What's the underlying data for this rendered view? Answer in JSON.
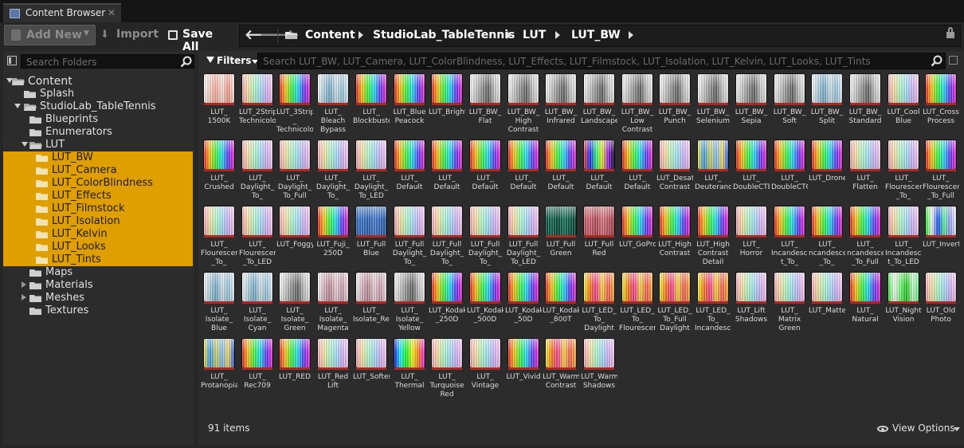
{
  "tab": {
    "title": "Content Browser",
    "close": "✕"
  },
  "toolbar": {
    "add_new": "Add New",
    "import": "Import",
    "save_all": "Save All"
  },
  "breadcrumbs": [
    "Content",
    "StudioLab_TableTennis",
    "LUT",
    "LUT_BW"
  ],
  "folder_search": {
    "placeholder": "Search Folders"
  },
  "tree": [
    {
      "label": "Content",
      "depth": 0,
      "arrow": "open",
      "selected": false
    },
    {
      "label": "Splash",
      "depth": 1,
      "arrow": "none",
      "selected": false
    },
    {
      "label": "StudioLab_TableTennis",
      "depth": 1,
      "arrow": "open",
      "selected": false
    },
    {
      "label": "Blueprints",
      "depth": 2,
      "arrow": "none",
      "selected": false
    },
    {
      "label": "Enumerators",
      "depth": 2,
      "arrow": "none",
      "selected": false
    },
    {
      "label": "LUT",
      "depth": 2,
      "arrow": "open",
      "selected": false
    },
    {
      "label": "LUT_BW",
      "depth": 3,
      "arrow": "none",
      "selected": true
    },
    {
      "label": "LUT_Camera",
      "depth": 3,
      "arrow": "none",
      "selected": true
    },
    {
      "label": "LUT_ColorBlindness",
      "depth": 3,
      "arrow": "none",
      "selected": true
    },
    {
      "label": "LUT_Effects",
      "depth": 3,
      "arrow": "none",
      "selected": true
    },
    {
      "label": "LUT_Filmstock",
      "depth": 3,
      "arrow": "none",
      "selected": true
    },
    {
      "label": "LUT_Isolation",
      "depth": 3,
      "arrow": "none",
      "selected": true
    },
    {
      "label": "LUT_Kelvin",
      "depth": 3,
      "arrow": "none",
      "selected": true
    },
    {
      "label": "LUT_Looks",
      "depth": 3,
      "arrow": "none",
      "selected": true
    },
    {
      "label": "LUT_Tints",
      "depth": 3,
      "arrow": "none",
      "selected": true
    },
    {
      "label": "Maps",
      "depth": 2,
      "arrow": "none",
      "selected": false
    },
    {
      "label": "Materials",
      "depth": 2,
      "arrow": "closed",
      "selected": false
    },
    {
      "label": "Meshes",
      "depth": 2,
      "arrow": "closed",
      "selected": false
    },
    {
      "label": "Textures",
      "depth": 2,
      "arrow": "none",
      "selected": false
    }
  ],
  "filters": {
    "label": "Filters"
  },
  "asset_search": {
    "placeholder": "Search LUT_BW, LUT_Camera, LUT_ColorBlindness, LUT_Effects, LUT_Filmstock, LUT_Isolation, LUT_Kelvin, LUT_Looks, LUT_Tints"
  },
  "assets": [
    {
      "label": "LUT_\n1500K",
      "palette": "white-red"
    },
    {
      "label": "LUT_2Strip\nTechnicolor",
      "palette": "pastel"
    },
    {
      "label": "LUT_3Strip\n_\nTechnicolor",
      "palette": "rainbow"
    },
    {
      "label": "LUT_\nBleach\nBypass",
      "palette": "grey-cool"
    },
    {
      "label": "LUT_\nBlockbuster",
      "palette": "rainbow"
    },
    {
      "label": "LUT_Blue\nPeacock",
      "palette": "rainbow"
    },
    {
      "label": "LUT_Bright",
      "palette": "rainbow"
    },
    {
      "label": "LUT_BW_\nFlat",
      "palette": "grey"
    },
    {
      "label": "LUT_BW_\nHigh\nContrast",
      "palette": "grey"
    },
    {
      "label": "LUT_BW_\nInfrared",
      "palette": "grey"
    },
    {
      "label": "LUT_BW_\nLandscape",
      "palette": "grey"
    },
    {
      "label": "LUT_BW_\nLow\nContrast",
      "palette": "grey"
    },
    {
      "label": "LUT_BW_\nPunch",
      "palette": "grey"
    },
    {
      "label": "LUT_BW_\nSelenium",
      "palette": "grey"
    },
    {
      "label": "LUT_BW_\nSepia",
      "palette": "grey"
    },
    {
      "label": "LUT_BW_\nSoft",
      "palette": "grey"
    },
    {
      "label": "LUT_BW_\nSplit",
      "palette": "grey-cool"
    },
    {
      "label": "LUT_BW_\nStandard",
      "palette": "grey"
    },
    {
      "label": "LUT_Cool\nBlue",
      "palette": "pastel"
    },
    {
      "label": "LUT_Cross\nProcess",
      "palette": "rainbow"
    },
    {
      "label": "LUT_\nCrushed",
      "palette": "rainbow"
    },
    {
      "label": "LUT_\nDaylight_\nTo_",
      "palette": "pastel"
    },
    {
      "label": "LUT_\nDaylight_\nTo_Full",
      "palette": "pastel"
    },
    {
      "label": "LUT_\nDaylight_\nTo_",
      "palette": "pastel"
    },
    {
      "label": "LUT_\nDaylight_\nTo_LED",
      "palette": "pastel"
    },
    {
      "label": "LUT_\nDefault",
      "palette": "rainbow"
    },
    {
      "label": "LUT_\nDefault",
      "palette": "rainbow"
    },
    {
      "label": "LUT_\nDefault",
      "palette": "rainbow"
    },
    {
      "label": "LUT_\nDefault",
      "palette": "rainbow"
    },
    {
      "label": "LUT_\nDefault",
      "palette": "rainbow"
    },
    {
      "label": "LUT_\nDefault",
      "palette": "dark"
    },
    {
      "label": "LUT_\nDefault",
      "palette": "rainbow"
    },
    {
      "label": "LUT_Desat\nContrast",
      "palette": "pastel"
    },
    {
      "label": "LUT_\nDeuteranopia",
      "palette": "yellow-blue"
    },
    {
      "label": "LUT_\nDoubleCTB",
      "palette": "rainbow"
    },
    {
      "label": "LUT_\nDoubleCTO",
      "palette": "rainbow"
    },
    {
      "label": "LUT_Drone",
      "palette": "rainbow"
    },
    {
      "label": "LUT_\nFlatten",
      "palette": "pastel"
    },
    {
      "label": "LUT_\nFlourescent\n_To_",
      "palette": "pastel"
    },
    {
      "label": "LUT_\nFlourescent\n_To_Full",
      "palette": "rainbow"
    },
    {
      "label": "LUT_\nFlourescent\n_To_",
      "palette": "pastel"
    },
    {
      "label": "LUT_\nFlourescent\n_To_LED",
      "palette": "pastel"
    },
    {
      "label": "LUT_Foggy",
      "palette": "pastel"
    },
    {
      "label": "LUT_Fuji_\n250D",
      "palette": "rainbow"
    },
    {
      "label": "LUT_Full\nBlue",
      "palette": "blue"
    },
    {
      "label": "LUT_Full\nDaylight_\nTo_",
      "palette": "pastel"
    },
    {
      "label": "LUT_Full\nDaylight_\nTo_",
      "palette": "pastel"
    },
    {
      "label": "LUT_Full\nDaylight_\nTo_",
      "palette": "pastel"
    },
    {
      "label": "LUT_Full\nDaylight_\nTo_LED",
      "palette": "pastel"
    },
    {
      "label": "LUT_Full\nGreen",
      "palette": "green"
    },
    {
      "label": "LUT_Full\nRed",
      "palette": "red"
    },
    {
      "label": "LUT_GoPro",
      "palette": "rainbow"
    },
    {
      "label": "LUT_High\nContrast",
      "palette": "rainbow"
    },
    {
      "label": "LUT_High\nContrast\nDetail",
      "palette": "rainbow"
    },
    {
      "label": "LUT_\nHorror",
      "palette": "pastel"
    },
    {
      "label": "LUT_\nIncandescen\nt_To_",
      "palette": "rainbow"
    },
    {
      "label": "LUT_\nncandescent\n_To_",
      "palette": "rainbow"
    },
    {
      "label": "LUT_\nncandescent\n_To_Full",
      "palette": "rainbow"
    },
    {
      "label": "LUT_\nIncandescen\nt_To_LED",
      "palette": "pastel"
    },
    {
      "label": "LUT_Invert",
      "palette": "invert"
    },
    {
      "label": "LUT_\nIsolate_\nBlue",
      "palette": "grey-cool"
    },
    {
      "label": "LUT_\nIsolate_\nCyan",
      "palette": "grey-cool"
    },
    {
      "label": "LUT_\nIsolate_\nGreen",
      "palette": "grey"
    },
    {
      "label": "LUT_\nIsolate_\nMagenta",
      "palette": "grey-warm"
    },
    {
      "label": "LUT_\nIsolate_Red",
      "palette": "grey-warm"
    },
    {
      "label": "LUT_\nIsolate_\nYellow",
      "palette": "grey"
    },
    {
      "label": "LUT_Kodak\n_250D",
      "palette": "rainbow"
    },
    {
      "label": "LUT_Kodak\n_500D",
      "palette": "rainbow"
    },
    {
      "label": "LUT_Kodak\n_50D",
      "palette": "rainbow"
    },
    {
      "label": "LUT_Kodak\n_800T",
      "palette": "rainbow"
    },
    {
      "label": "LUT_LED_\nTo_\nDaylight",
      "palette": "warm"
    },
    {
      "label": "LUT_LED_\nTo_\nFlourescent",
      "palette": "warm"
    },
    {
      "label": "LUT_LED_\nTo_Full\nDaylight",
      "palette": "warm"
    },
    {
      "label": "LUT_LED_\nTo_\nIncandescen",
      "palette": "warm"
    },
    {
      "label": "LUT_Lift\nShadows",
      "palette": "pastel"
    },
    {
      "label": "LUT_\nMatrix\nGreen",
      "palette": "pastel"
    },
    {
      "label": "LUT_Matte",
      "palette": "pastel"
    },
    {
      "label": "LUT_\nNatural",
      "palette": "rainbow"
    },
    {
      "label": "LUT_Night\nVision",
      "palette": "green-bright"
    },
    {
      "label": "LUT_Old\nPhoto",
      "palette": "pastel"
    },
    {
      "label": "LUT_\nProtanopia",
      "palette": "yellow-blue"
    },
    {
      "label": "LUT_\nRec709",
      "palette": "rainbow"
    },
    {
      "label": "LUT_RED",
      "palette": "rainbow"
    },
    {
      "label": "LUT_Red\nLift",
      "palette": "pastel"
    },
    {
      "label": "LUT_Soften",
      "palette": "pastel"
    },
    {
      "label": "LUT_\nThermal",
      "palette": "thermal"
    },
    {
      "label": "LUT_\nTurquoise\nRed",
      "palette": "pastel"
    },
    {
      "label": "LUT_\nVintage",
      "palette": "pastel"
    },
    {
      "label": "LUT_Vivid",
      "palette": "rainbow"
    },
    {
      "label": "LUT_Warm\nContrast",
      "palette": "warm"
    },
    {
      "label": "LUT_Warm\nShadows",
      "palette": "pastel"
    }
  ],
  "status": {
    "item_count": "91 items",
    "view_options": "View Options"
  },
  "colors": {
    "selection": "#e09f00",
    "panel": "#2c2c2c",
    "thumb_bar": "#a82a23"
  },
  "icons": {
    "tab": "content-browser-icon",
    "search": "search-icon",
    "folder": "folder-icon",
    "lock": "lock-icon",
    "eye": "eye-icon"
  }
}
